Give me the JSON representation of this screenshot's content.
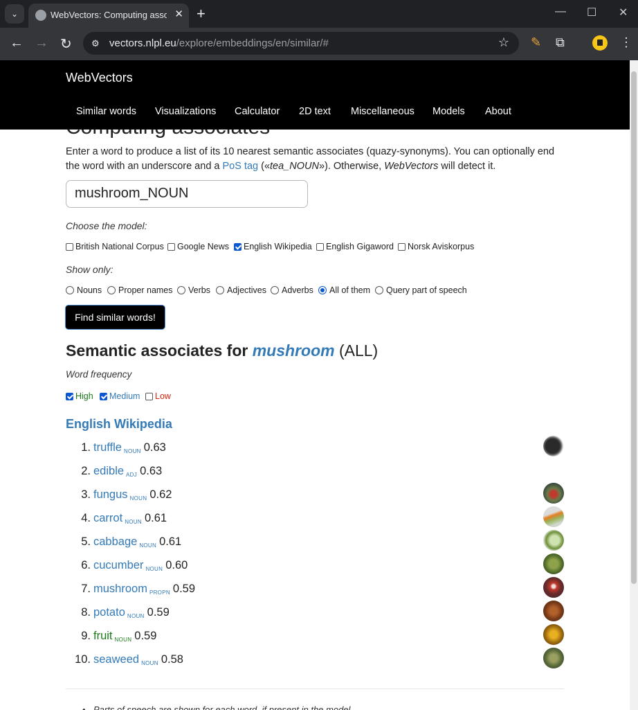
{
  "browser": {
    "tab_title": "WebVectors: Computing associates",
    "url_host": "vectors.nlpl.eu",
    "url_path": "/explore/embeddings/en/similar/#"
  },
  "site": {
    "brand": "WebVectors",
    "nav": [
      "Similar words",
      "Visualizations",
      "Calculator",
      "2D text",
      "Miscellaneous",
      "Models",
      "About"
    ]
  },
  "page": {
    "title": "Computing associates",
    "intro_1": "Enter a word to produce a list of its 10 nearest semantic associates (quazy-synonyms). You can optionally end the word with an underscore and a ",
    "intro_link": "PoS tag",
    "intro_2": " («",
    "intro_example": "tea_NOUN",
    "intro_3": "»). Otherwise, ",
    "intro_brand": "WebVectors",
    "intro_4": " will detect it.",
    "query_value": "mushroom_NOUN",
    "choose_model_label": "Choose the model:",
    "models": [
      {
        "label": "British National Corpus",
        "checked": false
      },
      {
        "label": "Google News",
        "checked": false
      },
      {
        "label": "English Wikipedia",
        "checked": true
      },
      {
        "label": "English Gigaword",
        "checked": false
      },
      {
        "label": "Norsk Aviskorpus",
        "checked": false
      }
    ],
    "show_only_label": "Show only:",
    "pos_filters": [
      {
        "label": "Nouns",
        "selected": false
      },
      {
        "label": "Proper names",
        "selected": false
      },
      {
        "label": "Verbs",
        "selected": false
      },
      {
        "label": "Adjectives",
        "selected": false
      },
      {
        "label": "Adverbs",
        "selected": false
      },
      {
        "label": "All of them",
        "selected": true
      },
      {
        "label": "Query part of speech",
        "selected": false
      }
    ],
    "submit_label": "Find similar words!"
  },
  "results": {
    "heading_prefix": "Semantic associates for ",
    "heading_word": "mushroom",
    "heading_suffix": " (ALL)",
    "frequency_label": "Word frequency",
    "frequency_filters": [
      {
        "label": "High",
        "checked": true,
        "color": "#1a7a1a"
      },
      {
        "label": "Medium",
        "checked": true,
        "color": "#337ab7"
      },
      {
        "label": "Low",
        "checked": false,
        "color": "#d9230f"
      }
    ],
    "model_name": "English Wikipedia",
    "items": [
      {
        "rank": "1.",
        "word": "truffle",
        "pos": "NOUN",
        "score": "0.63",
        "freq": "medium",
        "image": "truffle"
      },
      {
        "rank": "2.",
        "word": "edible",
        "pos": "ADJ",
        "score": "0.63",
        "freq": "medium",
        "image": ""
      },
      {
        "rank": "3.",
        "word": "fungus",
        "pos": "NOUN",
        "score": "0.62",
        "freq": "medium",
        "image": "fungus"
      },
      {
        "rank": "4.",
        "word": "carrot",
        "pos": "NOUN",
        "score": "0.61",
        "freq": "medium",
        "image": "carrot"
      },
      {
        "rank": "5.",
        "word": "cabbage",
        "pos": "NOUN",
        "score": "0.61",
        "freq": "medium",
        "image": "cabbage"
      },
      {
        "rank": "6.",
        "word": "cucumber",
        "pos": "NOUN",
        "score": "0.60",
        "freq": "medium",
        "image": "cucumber"
      },
      {
        "rank": "7.",
        "word": "mushroom",
        "pos": "PROPN",
        "score": "0.59",
        "freq": "medium",
        "image": "mushroom"
      },
      {
        "rank": "8.",
        "word": "potato",
        "pos": "NOUN",
        "score": "0.59",
        "freq": "medium",
        "image": "potato"
      },
      {
        "rank": "9.",
        "word": "fruit",
        "pos": "NOUN",
        "score": "0.59",
        "freq": "high",
        "image": "fruit"
      },
      {
        "rank": "10.",
        "word": "seaweed",
        "pos": "NOUN",
        "score": "0.58",
        "freq": "medium",
        "image": "seaweed"
      }
    ],
    "footnote": "Parts of speech are shown for each word, if present in the model."
  }
}
